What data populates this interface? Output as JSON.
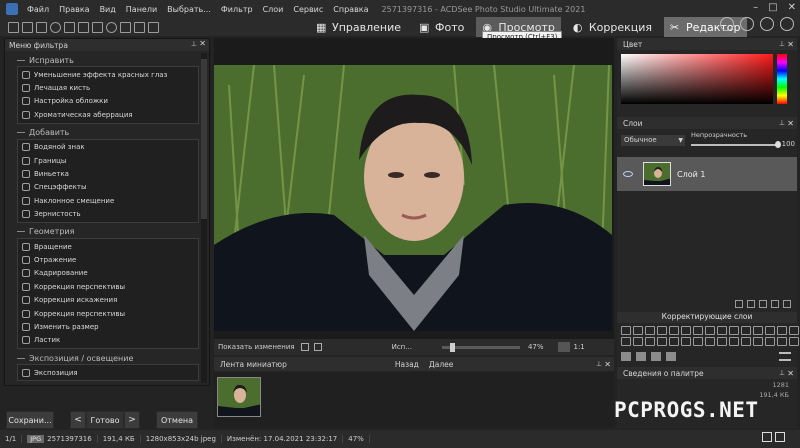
{
  "menubar": {
    "items": [
      "Файл",
      "Правка",
      "Вид",
      "Панели",
      "Выбрать...",
      "Фильтр",
      "Слои",
      "Сервис",
      "Справка"
    ],
    "window_title": "2571397316 - ACDSee Photo Studio Ultimate 2021"
  },
  "modes": [
    {
      "label": "Управление",
      "icon": "grid-icon"
    },
    {
      "label": "Фото",
      "icon": "photo-icon"
    },
    {
      "label": "Просмотр",
      "icon": "eye-icon"
    },
    {
      "label": "Коррекция",
      "icon": "adjust-icon"
    },
    {
      "label": "Редактор",
      "icon": "edit-icon"
    }
  ],
  "tooltip": "Просмотр (Ctrl+F3)",
  "filter_menu": {
    "title": "Меню фильтра",
    "groups": [
      {
        "title": "Исправить",
        "items": [
          "Уменьшение эффекта красных глаз",
          "Лечащая кисть",
          "Настройка обложки",
          "Хроматическая аберрация"
        ]
      },
      {
        "title": "Добавить",
        "items": [
          "Водяной знак",
          "Границы",
          "Виньетка",
          "Спецэффекты",
          "Наклонное смещение",
          "Зернистость"
        ]
      },
      {
        "title": "Геометрия",
        "items": [
          "Вращение",
          "Отражение",
          "Кадрирование",
          "Коррекция перспективы",
          "Коррекция искажения",
          "Коррекция перспективы",
          "Изменить размер",
          "Ластик"
        ]
      },
      {
        "title": "Экспозиция / освещение",
        "items": [
          "Экспозиция"
        ]
      }
    ]
  },
  "left_buttons": {
    "save": "Сохрани...",
    "prev": "<",
    "done": "Готово",
    "next": ">",
    "cancel": "Отмена"
  },
  "viewer_bar": {
    "show_changes": "Показать изменения",
    "source": "Исп...",
    "zoom": "47%",
    "one_to_one": "1:1"
  },
  "filmstrip": {
    "title": "Лента миниатюр",
    "back": "Назад",
    "forward": "Далее"
  },
  "right_panel": {
    "color_title": "Цвет",
    "layers_title": "Слои",
    "blend_mode": "Обычное",
    "opacity_label": "Непрозрачность",
    "opacity_value": "100",
    "layer_name": "Слой 1",
    "adjust_layers_title": "Корректирующие слои",
    "palette_title": "Сведения о палитре",
    "palette_val1": "1281",
    "palette_val2": "191,4 КБ"
  },
  "statusbar": {
    "page": "1/1",
    "format": "JPG",
    "filename": "2571397316",
    "size": "191,4 КБ",
    "dims": "1280x853x24b jpeg",
    "modified": "Изменён: 17.04.2021 23:32:17",
    "zoom": "47%"
  },
  "watermark": "PCPROGS.NET",
  "colors": {
    "bg": "#232323",
    "panel": "#262626",
    "active_tab": "#5b5b5b"
  }
}
